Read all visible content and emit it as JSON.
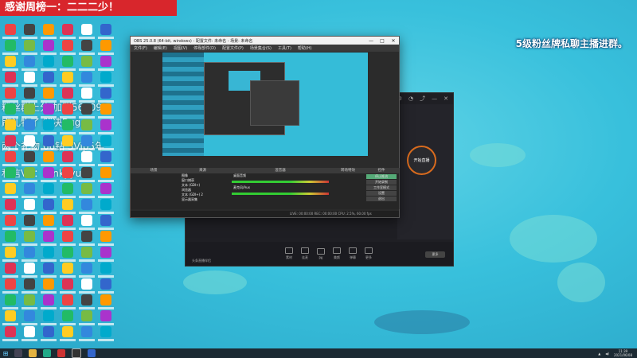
{
  "banner": {
    "text": "感谢周榜一：二二二少！"
  },
  "overlay_right": {
    "text": "5级粉丝牌私聊主播进群。"
  },
  "overlay_left": {
    "lines": [
      "粉丝群上分 加群565091",
      "刷礼物了 解决Bug",
      "两个礼物 66钻 3Vip5年",
      "私信VX：funkyyuu"
    ]
  },
  "obs": {
    "title": "OBS 25.0.8 (64-bit, windows) - 配置文件: 未命名 - 场景: 未命名",
    "menu": [
      "文件(F)",
      "编辑(E)",
      "视图(V)",
      "停靠部件(D)",
      "配置文件(P)",
      "场景集合(S)",
      "工具(T)",
      "帮助(H)"
    ],
    "docks": {
      "scenes": "场景",
      "sources": "来源",
      "mixer": "混音器",
      "transitions": "转场特效",
      "controls": "控件"
    },
    "sources": [
      "图像",
      "窗口捕获",
      "文本 (GDI+)",
      "浏览器",
      "文本 (GDI+) 2",
      "显示器采集"
    ],
    "mixer_channels": [
      "桌面音频",
      "麦克风/Aux"
    ],
    "controls": [
      "停止推流",
      "开始录制",
      "工作室模式",
      "设置",
      "退出"
    ],
    "status": "LIVE: 00:00:00   REC: 00:00:00   CPU: 2.5%, 60.00 fps"
  },
  "companion": {
    "start_live": "开始直播",
    "tabs": [
      "直播",
      "主播",
      "观众"
    ],
    "tools": [
      "素材",
      "连麦",
      "PK",
      "美颜",
      "弹幕",
      "更多"
    ],
    "footer": "头条直播伴侣",
    "button": "更多"
  },
  "taskbar": {
    "time": "11:39",
    "date": "2021/06/08"
  }
}
